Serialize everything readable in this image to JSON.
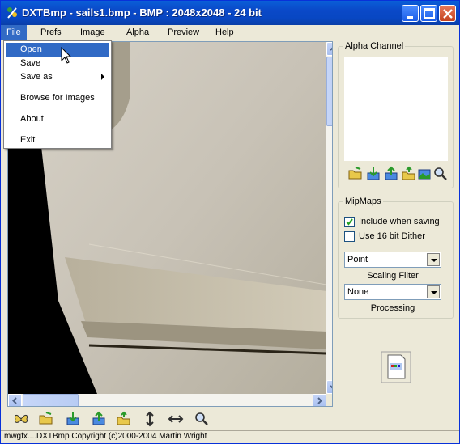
{
  "window": {
    "title": "DXTBmp - sails1.bmp - BMP : 2048x2048 - 24 bit"
  },
  "menu": {
    "items": [
      {
        "label": "File"
      },
      {
        "label": "Prefs"
      },
      {
        "label": "Image"
      },
      {
        "label": "Alpha"
      },
      {
        "label": "Preview"
      },
      {
        "label": "Help"
      }
    ]
  },
  "file_menu": {
    "items": [
      {
        "label": "Open"
      },
      {
        "label": "Save"
      },
      {
        "label": "Save as"
      },
      {
        "label": "Browse for Images"
      },
      {
        "label": "About"
      },
      {
        "label": "Exit"
      }
    ]
  },
  "alpha_panel": {
    "title": "Alpha Channel"
  },
  "mipmaps": {
    "title": "MipMaps",
    "include_label": "Include when saving",
    "include_checked": true,
    "dither_label": "Use 16 bit Dither",
    "dither_checked": false,
    "scaling_value": "Point",
    "scaling_caption": "Scaling Filter",
    "processing_value": "None",
    "processing_caption": "Processing"
  },
  "status": {
    "text": "mwgfx....DXTBmp Copyright (c)2000-2004 Martin Wright"
  },
  "colors": {
    "titlebar": "#0a48c8",
    "highlight": "#316ac5",
    "face": "#ece9d8"
  }
}
